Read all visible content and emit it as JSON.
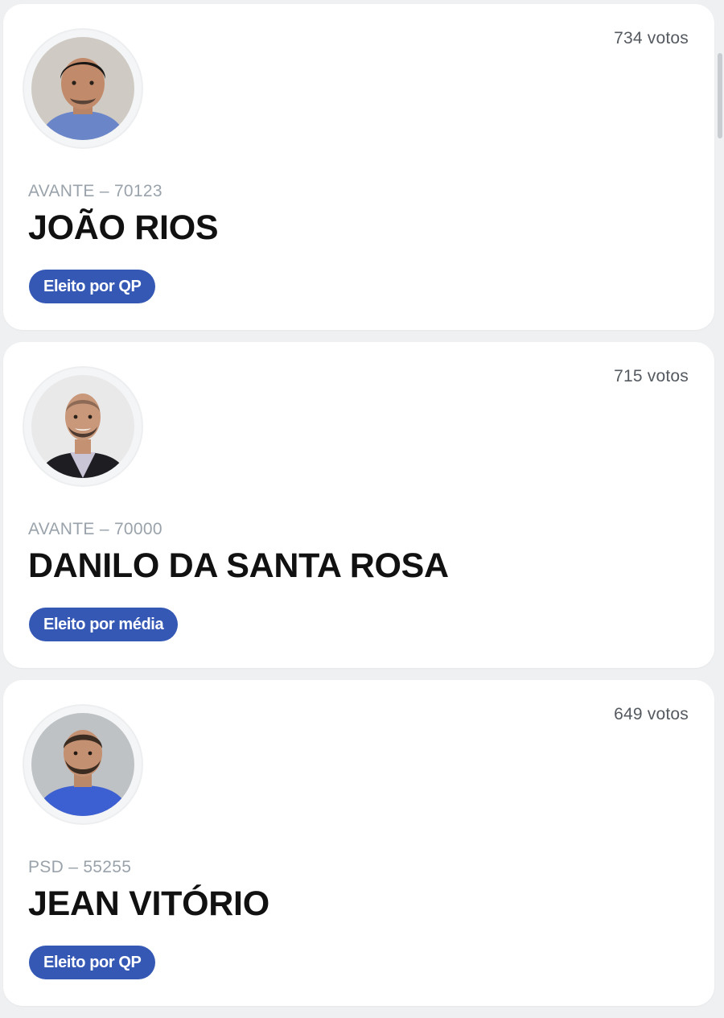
{
  "candidates": [
    {
      "votes": "734 votos",
      "party": "AVANTE – 70123",
      "name": "JOÃO RIOS",
      "status": "Eleito por QP",
      "avatar": "person-photo-icon",
      "shirt_color": "#6a86c9",
      "bg_color": "#cfcbc4"
    },
    {
      "votes": "715 votos",
      "party": "AVANTE – 70000",
      "name": "DANILO DA SANTA ROSA",
      "status": "Eleito por média",
      "avatar": "person-photo-icon",
      "shirt_color": "#1d1d22",
      "bg_color": "#e9e9ea"
    },
    {
      "votes": "649 votos",
      "party": "PSD – 55255",
      "name": "JEAN VITÓRIO",
      "status": "Eleito por QP",
      "avatar": "person-photo-icon",
      "shirt_color": "#3c5fd1",
      "bg_color": "#bfc2c5"
    }
  ],
  "colors": {
    "badge": "#3558b5",
    "party_text": "#9aa3ab",
    "name_text": "#111111"
  }
}
